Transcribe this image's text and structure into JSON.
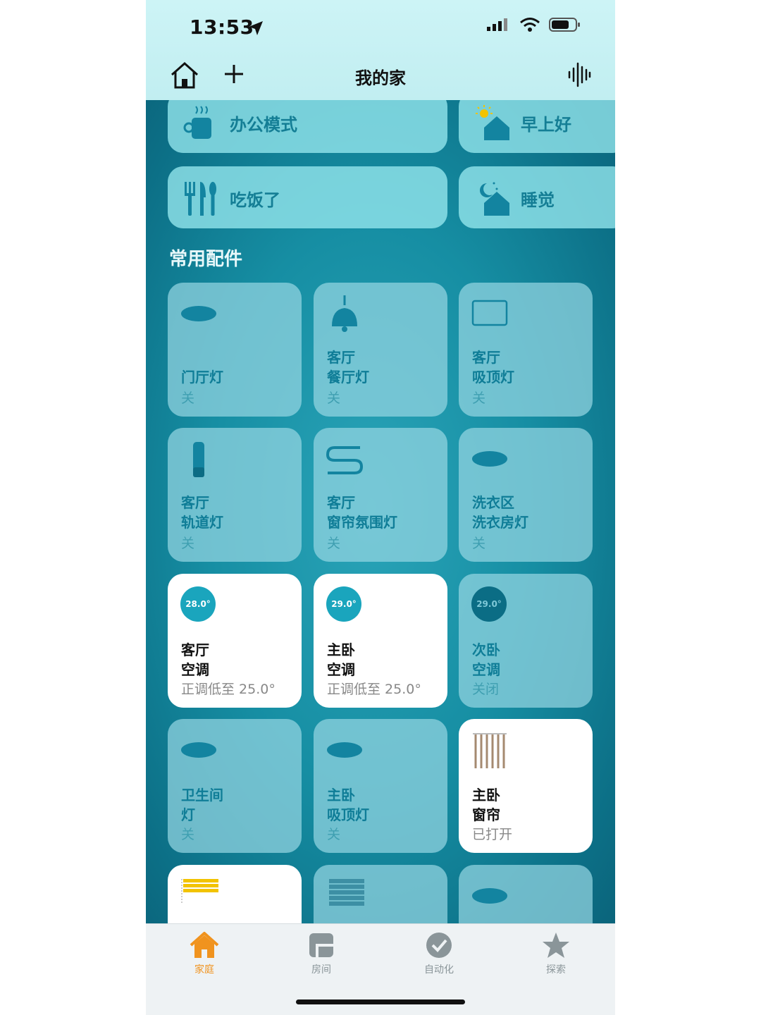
{
  "status_bar": {
    "time": "13:53"
  },
  "header": {
    "title": "我的家"
  },
  "scenes": [
    {
      "label": "办公模式",
      "icon": "coffee-cup-icon"
    },
    {
      "label": "早上好",
      "icon": "sunrise-house-icon"
    },
    {
      "label": "吃饭了",
      "icon": "fork-knife-icon"
    },
    {
      "label": "睡觉",
      "icon": "moon-house-icon"
    }
  ],
  "section_title": "常用配件",
  "accessories": [
    {
      "line1": "门厅灯",
      "line2": "",
      "status": "关",
      "icon": "ceiling-light-icon",
      "on": false
    },
    {
      "line1": "客厅",
      "line2": "餐厅灯",
      "status": "关",
      "icon": "pendant-lamp-icon",
      "on": false
    },
    {
      "line1": "客厅",
      "line2": "吸顶灯",
      "status": "关",
      "icon": "panel-light-icon",
      "on": false
    },
    {
      "line1": "客厅",
      "line2": "轨道灯",
      "status": "关",
      "icon": "track-light-icon",
      "on": false
    },
    {
      "line1": "客厅",
      "line2": "窗帘氛围灯",
      "status": "关",
      "icon": "light-strip-icon",
      "on": false
    },
    {
      "line1": "洗衣区",
      "line2": "洗衣房灯",
      "status": "关",
      "icon": "ceiling-light-icon",
      "on": false
    },
    {
      "line1": "客厅",
      "line2": "空调",
      "status": "正调低至 25.0°",
      "temp": "28.0°",
      "icon": "thermostat-icon",
      "on": true
    },
    {
      "line1": "主卧",
      "line2": "空调",
      "status": "正调低至 25.0°",
      "temp": "29.0°",
      "icon": "thermostat-icon",
      "on": true
    },
    {
      "line1": "次卧",
      "line2": "空调",
      "status": "关闭",
      "temp": "29.0°",
      "icon": "thermostat-icon",
      "on": false
    },
    {
      "line1": "卫生间",
      "line2": "灯",
      "status": "关",
      "icon": "ceiling-light-icon",
      "on": false
    },
    {
      "line1": "主卧",
      "line2": "吸顶灯",
      "status": "关",
      "icon": "ceiling-light-icon",
      "on": false
    },
    {
      "line1": "主卧",
      "line2": "窗帘",
      "status": "已打开",
      "icon": "curtain-icon",
      "on": true
    }
  ],
  "tabs": [
    {
      "label": "家庭",
      "icon": "home-tab-icon",
      "active": true
    },
    {
      "label": "房间",
      "icon": "rooms-tab-icon",
      "active": false
    },
    {
      "label": "自动化",
      "icon": "automation-tab-icon",
      "active": false
    },
    {
      "label": "探索",
      "icon": "discover-tab-icon",
      "active": false
    }
  ],
  "colors": {
    "accent": "#f0931e",
    "tile_text": "#0f7d97",
    "temp_circle": "#1aa5bd"
  }
}
